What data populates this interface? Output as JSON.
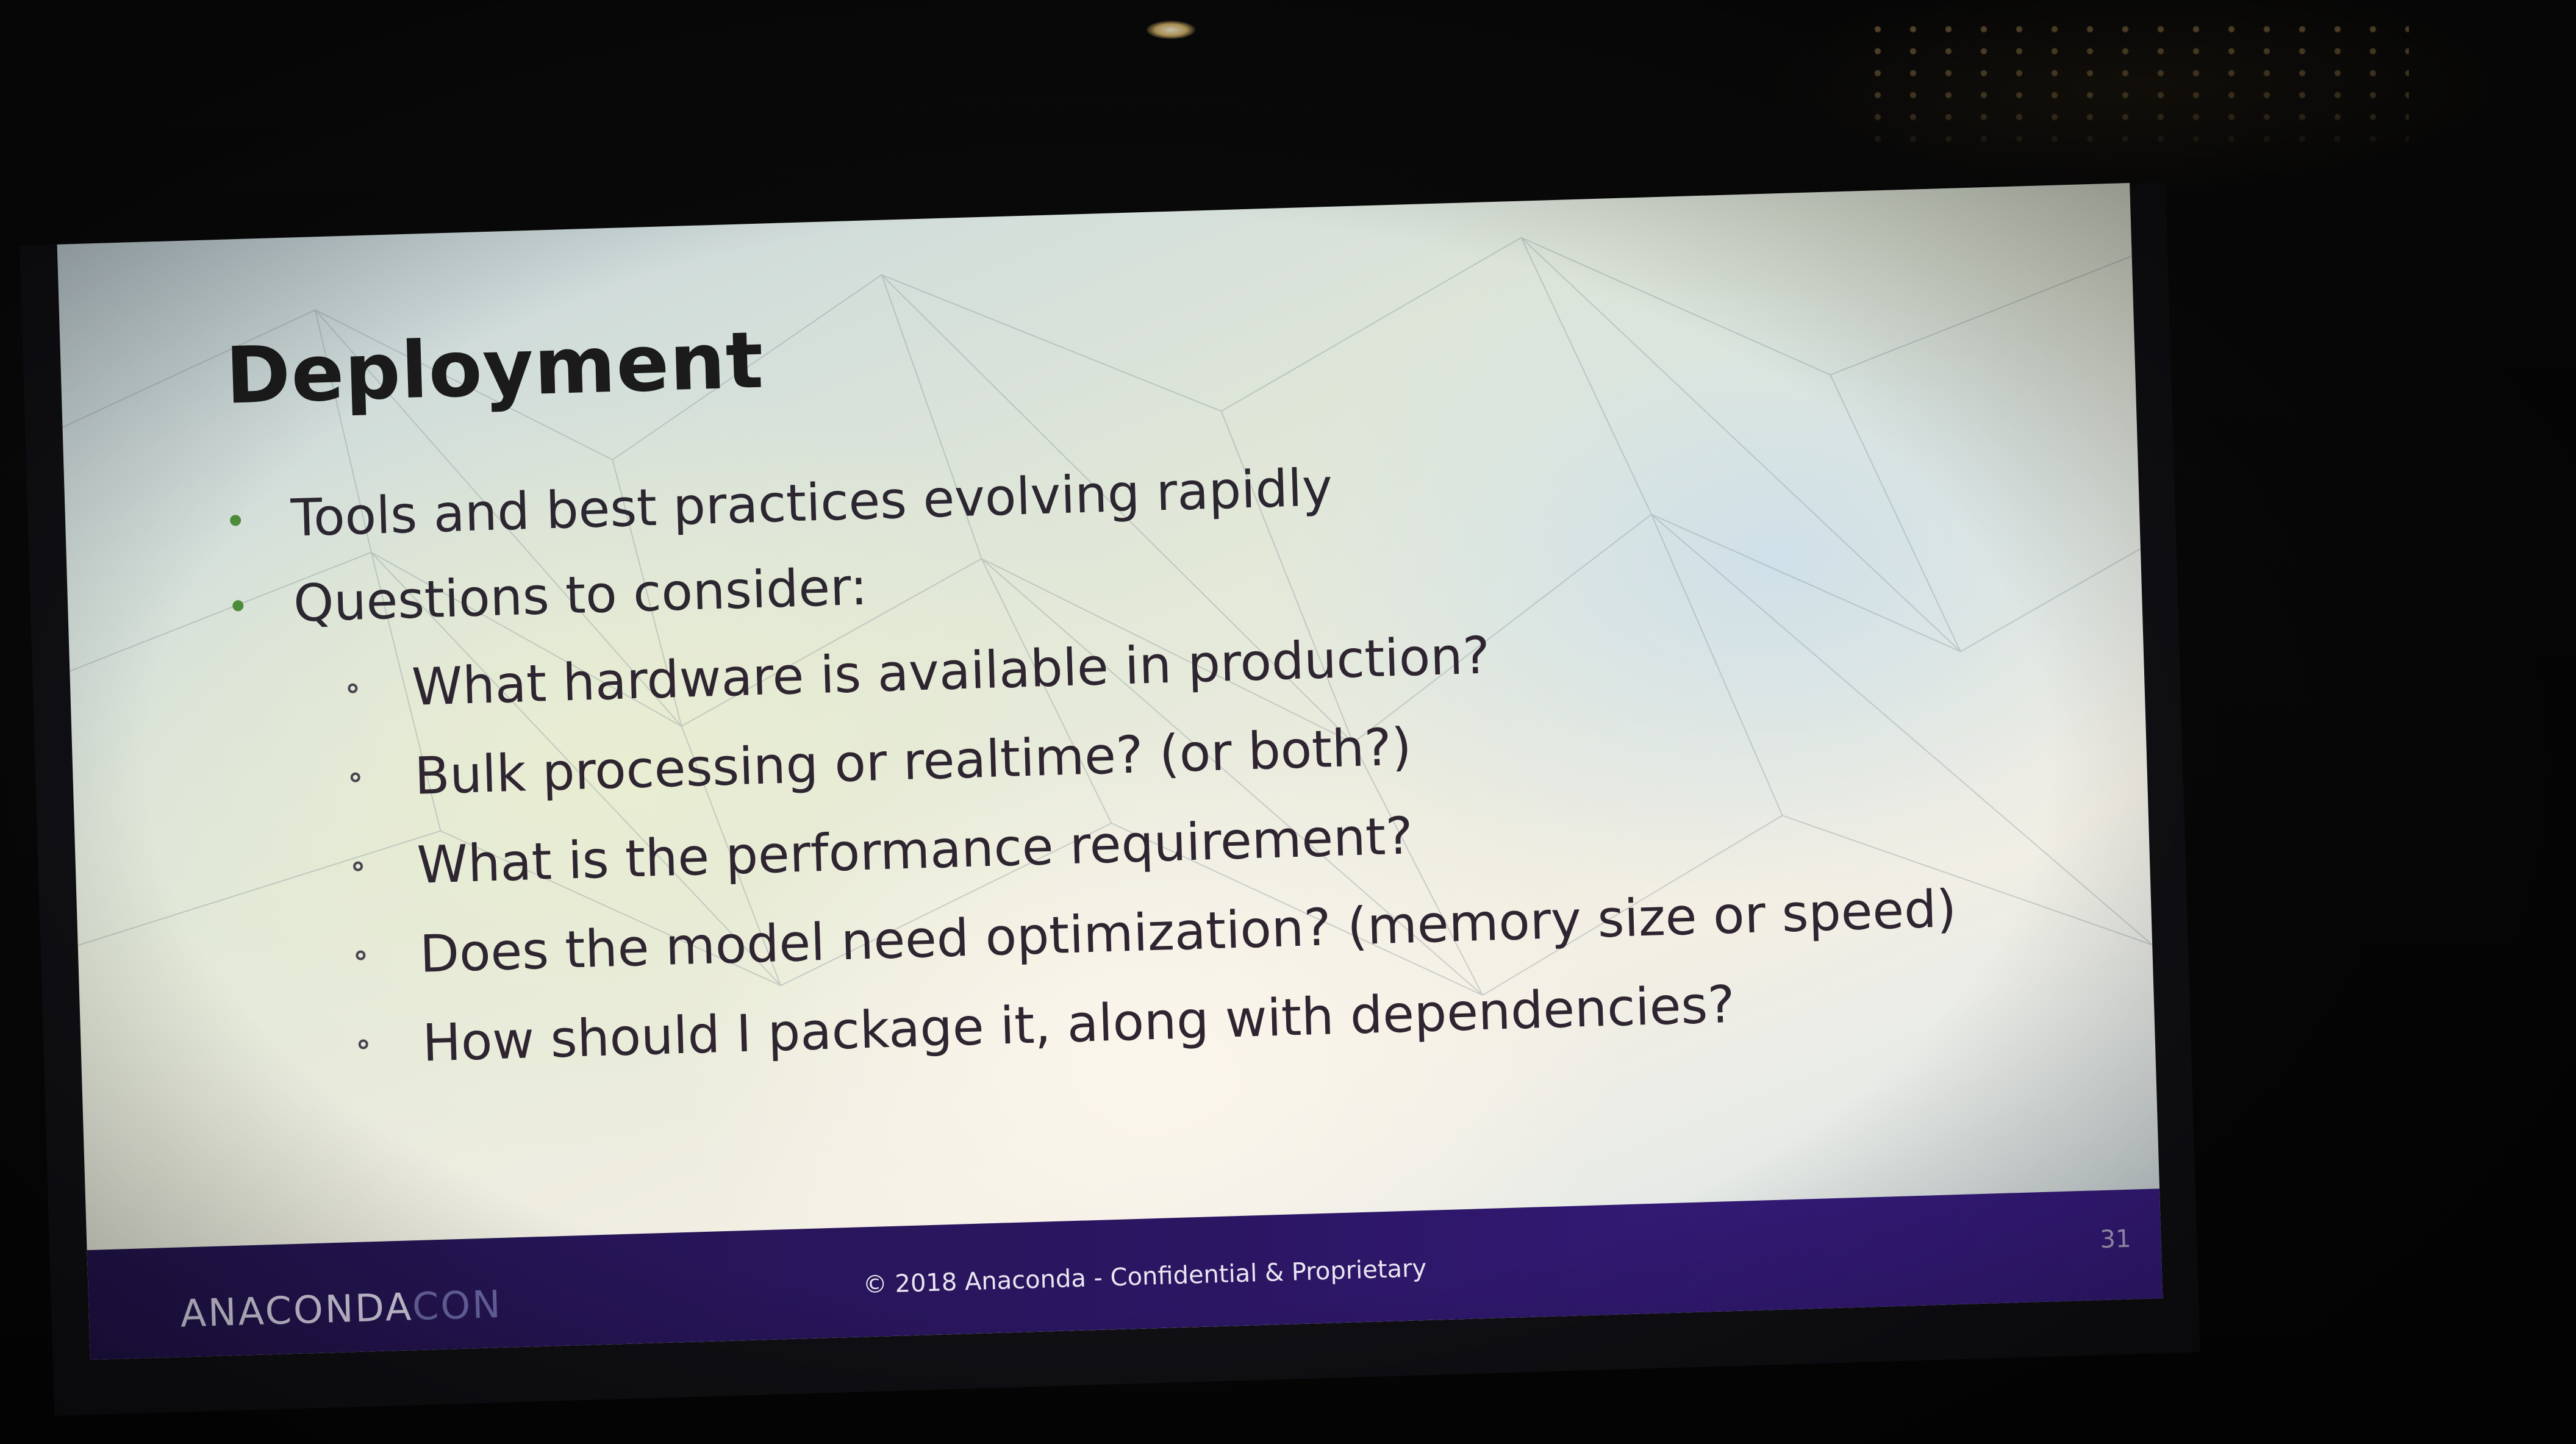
{
  "slide": {
    "title": "Deployment",
    "bullets": [
      {
        "text": "Tools and best practices evolving rapidly"
      },
      {
        "text": "Questions to consider:",
        "sub_bullets": [
          "What hardware is available in production?",
          "Bulk processing or realtime? (or both?)",
          "What is the performance requirement?",
          "Does the model need optimization? (memory size or speed)",
          "How should I package it, along with dependencies?"
        ]
      }
    ],
    "footer": {
      "logo_main": "ANACONDA",
      "logo_accent": "CON",
      "copyright": "© 2018 Anaconda - Confidential & Proprietary",
      "page_number": "31"
    }
  },
  "colors": {
    "footer_bar": "#2b1663",
    "bullet_dot": "#4d8b3a",
    "title_text": "#1b1b1b"
  },
  "icons": {
    "bullet": "filled-circle",
    "sub_bullet": "hollow-circle"
  }
}
